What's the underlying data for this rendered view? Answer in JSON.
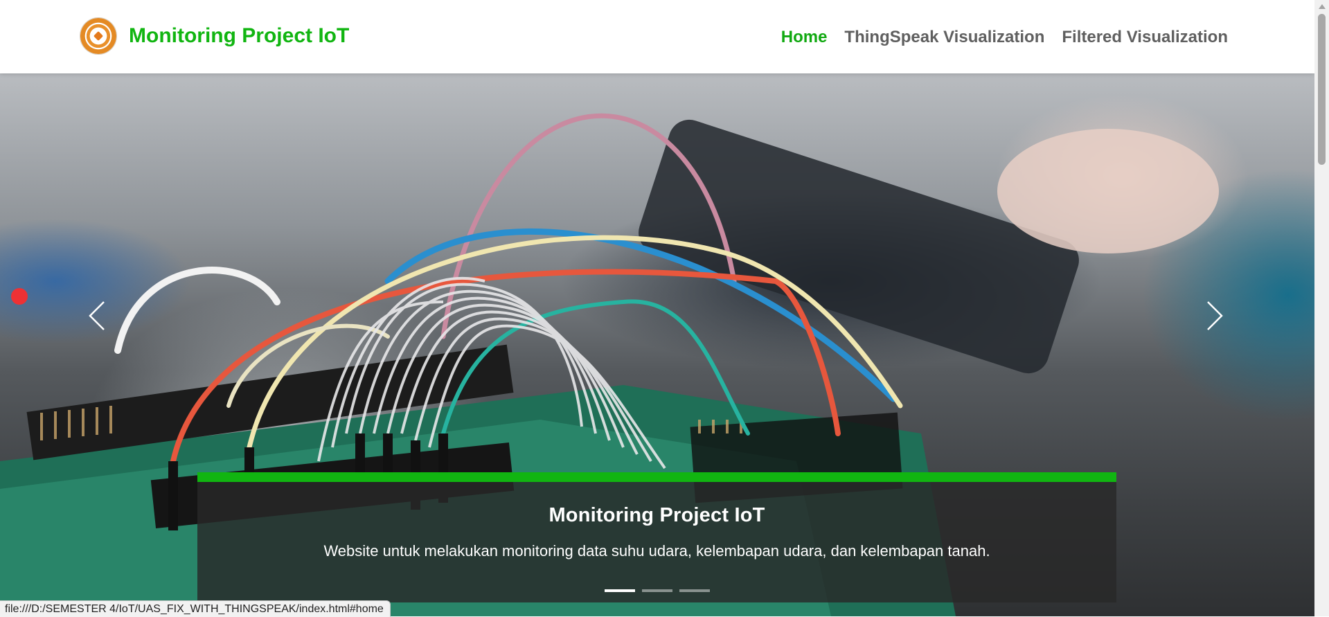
{
  "navbar": {
    "brand_title": "Monitoring Project IoT",
    "logo_icon": "university-seal-logo",
    "links": [
      {
        "label": "Home",
        "active": true
      },
      {
        "label": "ThingSpeak Visualization",
        "active": false
      },
      {
        "label": "Filtered Visualization",
        "active": false
      }
    ],
    "active_color": "#11a911",
    "inactive_color": "#5f5f5f"
  },
  "hero": {
    "caption_title": "Monitoring Project IoT",
    "caption_text": "Website untuk melakukan monitoring data suhu udara, kelembapan udara, dan kelembapan tanah.",
    "accent_color": "#11b511",
    "prev_icon": "chevron-left-icon",
    "next_icon": "chevron-right-icon",
    "slide_count": 3,
    "active_slide": 1
  },
  "statusbar": {
    "url": "file:///D:/SEMESTER 4/IoT/UAS_FIX_WITH_THINGSPEAK/index.html#home"
  }
}
